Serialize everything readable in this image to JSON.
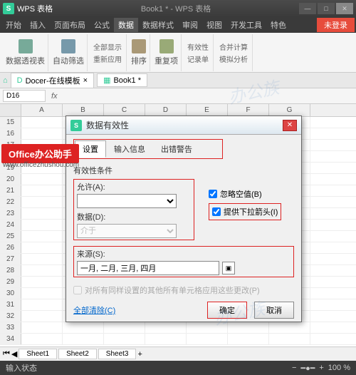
{
  "titlebar": {
    "app": "WPS 表格",
    "doc": "Book1 * - WPS 表格"
  },
  "winbtns": {
    "min": "—",
    "max": "□",
    "close": "✕"
  },
  "menu": {
    "items": [
      "开始",
      "插入",
      "页面布局",
      "公式",
      "数据",
      "数据样式",
      "审阅",
      "视图",
      "开发工具",
      "特色"
    ],
    "active_index": 4,
    "login": "未登录"
  },
  "ribbon": {
    "pivot": "数据透视表",
    "autofilter": "自动筛选",
    "show_all": "全部显示",
    "reapply": "重新应用",
    "sort": "排序",
    "dup": "重复项",
    "validity": "有效性",
    "consolidate": "合并计算",
    "record": "记录单",
    "analysis": "模拟分析"
  },
  "tabs": {
    "template": "Docer-在线模板",
    "book": "Book1 *"
  },
  "formula": {
    "namebox": "D16",
    "fx": "fx"
  },
  "cols": [
    "A",
    "B",
    "C",
    "D",
    "E",
    "F",
    "G"
  ],
  "rows": [
    15,
    16,
    17,
    18,
    19,
    20,
    21,
    22,
    23,
    24,
    25,
    26,
    27,
    28,
    29,
    30,
    31,
    32,
    33,
    34
  ],
  "dialog": {
    "title": "数据有效性",
    "tabs": [
      "设置",
      "输入信息",
      "出错警告"
    ],
    "criteria_label": "有效性条件",
    "allow_label": "允许(A):",
    "allow_value": "",
    "data_label": "数据(D):",
    "data_value": "介于",
    "ignore_blank": "忽略空值(B)",
    "dropdown_arrow": "提供下拉箭头(I)",
    "source_label": "来源(S):",
    "source_value": "一月, 二月, 三月, 四月",
    "apply_all": "对所有同样设置的其他所有单元格应用这些更改(P)",
    "clear": "全部清除(C)",
    "ok": "确定",
    "cancel": "取消",
    "logo": "S",
    "close": "✕"
  },
  "sheets": [
    "Sheet1",
    "Sheet2",
    "Sheet3"
  ],
  "status": {
    "text": "输入状态",
    "zoom": "100 %"
  },
  "overlay": {
    "badge": "Office办公助手",
    "url": "www.officezhushou.com"
  },
  "watermark": "办公族"
}
